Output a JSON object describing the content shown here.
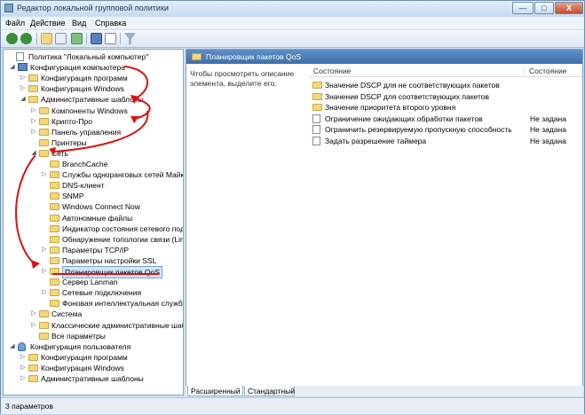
{
  "window": {
    "title": "Редактор локальной групповой политики",
    "minimize_label": "—",
    "maximize_label": "□",
    "close_label": "X"
  },
  "menu": [
    "Файл",
    "Действие",
    "Вид",
    "Справка"
  ],
  "toolbar": {
    "icons": [
      "back-icon",
      "forward-icon",
      "folder-icon",
      "tree-toggle-icon",
      "export-icon",
      "help-icon",
      "properties-icon",
      "filter-icon"
    ]
  },
  "tree": [
    {
      "label": "Политика \"Локальный компьютер\"",
      "level": 0,
      "icon": "doc",
      "exp": ""
    },
    {
      "label": "Конфигурация компьютера",
      "level": 1,
      "icon": "pc",
      "exp": "◢"
    },
    {
      "label": "Конфигурация программ",
      "level": 2,
      "icon": "folder",
      "exp": "▷"
    },
    {
      "label": "Конфигурация Windows",
      "level": 2,
      "icon": "folder",
      "exp": "▷"
    },
    {
      "label": "Административные шаблоны",
      "level": 2,
      "icon": "folder",
      "exp": "◢"
    },
    {
      "label": "Компоненты Windows",
      "level": 3,
      "icon": "folder",
      "exp": "▷"
    },
    {
      "label": "Крипто-Про",
      "level": 3,
      "icon": "folder",
      "exp": "▷"
    },
    {
      "label": "Панель управления",
      "level": 3,
      "icon": "folder",
      "exp": "▷"
    },
    {
      "label": "Принтеры",
      "level": 3,
      "icon": "folder",
      "exp": ""
    },
    {
      "label": "Сеть",
      "level": 3,
      "icon": "folder",
      "exp": "◢"
    },
    {
      "label": "BranchCache",
      "level": 4,
      "icon": "folder",
      "exp": ""
    },
    {
      "label": "Службы одноранговых сетей Майкр",
      "level": 4,
      "icon": "folder",
      "exp": "▷"
    },
    {
      "label": "DNS-клиент",
      "level": 4,
      "icon": "folder",
      "exp": ""
    },
    {
      "label": "SNMP",
      "level": 4,
      "icon": "folder",
      "exp": ""
    },
    {
      "label": "Windows Connect Now",
      "level": 4,
      "icon": "folder",
      "exp": ""
    },
    {
      "label": "Автономные файлы",
      "level": 4,
      "icon": "folder",
      "exp": ""
    },
    {
      "label": "Индикатор состояния сетевого подк",
      "level": 4,
      "icon": "folder",
      "exp": ""
    },
    {
      "label": "Обнаружение топологии связи (Lin",
      "level": 4,
      "icon": "folder",
      "exp": ""
    },
    {
      "label": "Параметры TCP/IP",
      "level": 4,
      "icon": "folder",
      "exp": "▷"
    },
    {
      "label": "Параметры настройки SSL",
      "level": 4,
      "icon": "folder",
      "exp": ""
    },
    {
      "label": "Планировщик пакетов QoS",
      "level": 4,
      "icon": "folder",
      "exp": "▷",
      "selected": true
    },
    {
      "label": "Сервер Lanman",
      "level": 4,
      "icon": "folder",
      "exp": ""
    },
    {
      "label": "Сетевые подключения",
      "level": 4,
      "icon": "folder",
      "exp": "▷"
    },
    {
      "label": "Фоновая интеллектуальная служба",
      "level": 4,
      "icon": "folder",
      "exp": ""
    },
    {
      "label": "Система",
      "level": 3,
      "icon": "folder",
      "exp": "▷"
    },
    {
      "label": "Классические административные шабло",
      "level": 3,
      "icon": "folder",
      "exp": "▷"
    },
    {
      "label": "Все параметры",
      "level": 3,
      "icon": "folder",
      "exp": ""
    },
    {
      "label": "Конфигурация пользователя",
      "level": 1,
      "icon": "user",
      "exp": "◢"
    },
    {
      "label": "Конфигурация программ",
      "level": 2,
      "icon": "folder",
      "exp": "▷"
    },
    {
      "label": "Конфигурация Windows",
      "level": 2,
      "icon": "folder",
      "exp": "▷"
    },
    {
      "label": "Административные шаблоны",
      "level": 2,
      "icon": "folder",
      "exp": "▷"
    }
  ],
  "right": {
    "header": "Планировщик пакетов QoS",
    "description": "Чтобы просмотреть описание элемента, выделите его.",
    "col_setting": "Состояние",
    "col_state": "Состояние",
    "items": [
      {
        "label": "Значение DSCP для не соответствующих пакетов",
        "icon": "folder",
        "state": ""
      },
      {
        "label": "Значение DSCP для соответствующих пакетов",
        "icon": "folder",
        "state": ""
      },
      {
        "label": "Значение приоритета второго уровня",
        "icon": "folder",
        "state": ""
      },
      {
        "label": "Ограничение ожидающих обработки пакетов",
        "icon": "doc",
        "state": "Не задана"
      },
      {
        "label": "Ограничить резервируемую пропускную способность",
        "icon": "doc",
        "state": "Не задана"
      },
      {
        "label": "Задать разрешение таймера",
        "icon": "doc",
        "state": "Не задана"
      }
    ],
    "tabs": [
      "Расширенный",
      "Стандартный"
    ]
  },
  "status": "3 параметров",
  "colors": {
    "annotation": "#dd1111",
    "selection": "#cfe3fb"
  }
}
